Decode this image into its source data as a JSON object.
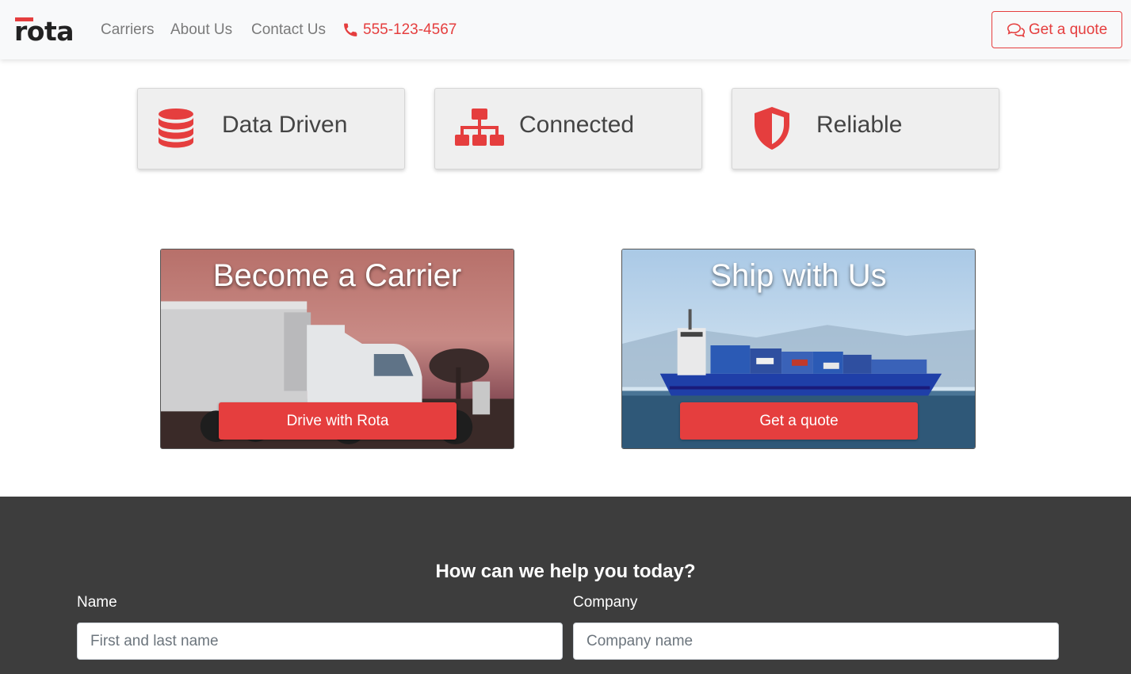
{
  "brand": {
    "name": "rota",
    "accent_color": "#e53e3e"
  },
  "nav": {
    "links": [
      "Carriers",
      "About Us",
      "Contact Us"
    ],
    "phone": {
      "icon": "phone-icon",
      "number": "555-123-4567"
    },
    "quote_button": {
      "icon": "chat-bubbles-icon",
      "label": "Get a quote"
    }
  },
  "features": [
    {
      "icon": "database-icon",
      "label": "Data Driven"
    },
    {
      "icon": "sitemap-icon",
      "label": "Connected"
    },
    {
      "icon": "shield-icon",
      "label": "Reliable"
    }
  ],
  "promos": [
    {
      "title": "Become a Carrier",
      "button": "Drive with Rota",
      "image": "semi-truck-at-sunset"
    },
    {
      "title": "Ship with Us",
      "button": "Get a quote",
      "image": "container-ship-at-sea"
    }
  ],
  "contact": {
    "heading": "How can we help you today?",
    "fields": [
      {
        "label": "Name",
        "placeholder": "First and last name",
        "value": ""
      },
      {
        "label": "Company",
        "placeholder": "Company name",
        "value": ""
      }
    ]
  }
}
